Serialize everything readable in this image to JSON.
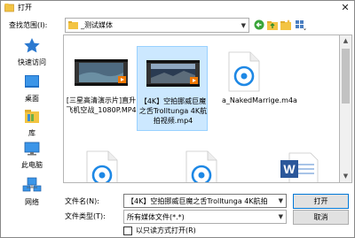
{
  "window": {
    "title": "打开"
  },
  "toolbar": {
    "lookin_label": "查找范围(I):",
    "lookin_value": "_测试媒体"
  },
  "places": [
    {
      "label": "快速访问",
      "icon": "star-icon"
    },
    {
      "label": "桌面",
      "icon": "desktop-icon"
    },
    {
      "label": "库",
      "icon": "library-icon"
    },
    {
      "label": "此电脑",
      "icon": "computer-icon"
    },
    {
      "label": "网络",
      "icon": "network-icon"
    }
  ],
  "files": [
    {
      "name": "[三星高清演示片]直升飞机空战_1080P.MP4",
      "type": "video",
      "selected": false
    },
    {
      "name": "【4K】空拍挪威巨魔之舌Trolltunga 4K航拍视频.mp4",
      "type": "video",
      "selected": true
    },
    {
      "name": "a_NakedMarrige.m4a",
      "type": "audio",
      "selected": false
    },
    {
      "name": "",
      "type": "audio",
      "selected": false
    },
    {
      "name": "",
      "type": "audio",
      "selected": false
    },
    {
      "name": "",
      "type": "word",
      "selected": false
    }
  ],
  "filename": {
    "label": "文件名(N):",
    "value": "【4K】空拍挪威巨魔之舌Trolltunga 4K航拍"
  },
  "filetype": {
    "label": "文件类型(T):",
    "value": "所有媒体文件(*.*)"
  },
  "buttons": {
    "open": "打开",
    "cancel": "取消"
  },
  "readonly": {
    "label": "以只读方式打开(R)",
    "checked": false
  },
  "colors": {
    "selection": "#cce8ff",
    "selection_border": "#99d1ff",
    "accent": "#0078d7"
  }
}
